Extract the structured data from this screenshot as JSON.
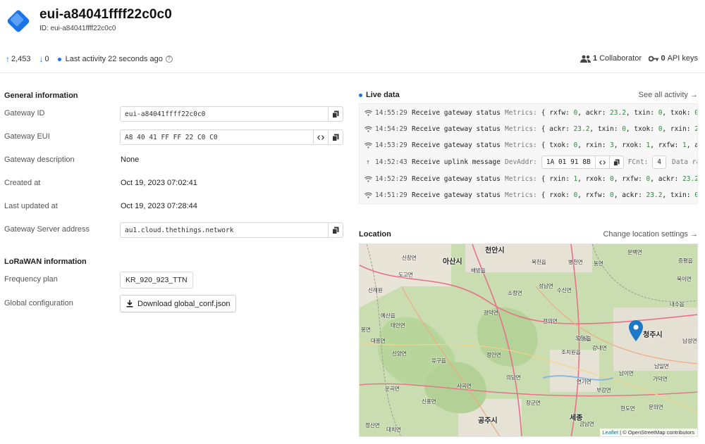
{
  "header": {
    "title": "eui-a84041ffff22c0c0",
    "id_label": "ID:",
    "id_value": "eui-a84041ffff22c0c0",
    "uplink_count": "2,453",
    "downlink_count": "0",
    "last_activity": "Last activity 22 seconds ago",
    "collaborators_count": "1",
    "collaborators_label": "Collaborator",
    "api_keys_count": "0",
    "api_keys_label": "API keys"
  },
  "general": {
    "title": "General information",
    "rows": [
      {
        "label": "Gateway ID",
        "value": "eui-a84041ffff22c0c0"
      },
      {
        "label": "Gateway EUI",
        "value": "A8 40 41 FF FF 22 C0 C0"
      },
      {
        "label": "Gateway description",
        "value": "None"
      },
      {
        "label": "Created at",
        "value": "Oct 19, 2023 07:02:41"
      },
      {
        "label": "Last updated at",
        "value": "Oct 19, 2023 07:28:44"
      },
      {
        "label": "Gateway Server address",
        "value": "au1.cloud.thethings.network"
      }
    ]
  },
  "lorawan": {
    "title": "LoRaWAN information",
    "frequency_label": "Frequency plan",
    "frequency_value": "KR_920_923_TTN",
    "global_label": "Global configuration",
    "download_label": "Download global_conf.json"
  },
  "live": {
    "title": "Live data",
    "see_all": "See all activity →",
    "events": [
      {
        "icon": "wifi-icon",
        "time": "14:55:29",
        "type": "Receive gateway status",
        "label": "Metrics:",
        "text": "{ rxfw: 0, ackr: 23.2, txin: 0, txok: 0, rxin: 1, rxok: 1 }"
      },
      {
        "icon": "wifi-icon",
        "time": "14:54:29",
        "type": "Receive gateway status",
        "label": "Metrics:",
        "text": "{ ackr: 23.2, txin: 0, txok: 0, rxin: 2, rxok: 2, rxfw: 0 }"
      },
      {
        "icon": "wifi-icon",
        "time": "14:53:29",
        "type": "Receive gateway status",
        "label": "Metrics:",
        "text": "{ txok: 0, rxin: 3, rxok: 1, rxfw: 1, ackr: 23.2, txin: 0 }"
      },
      {
        "icon": "arrow-up-icon",
        "time": "14:52:43",
        "type": "Receive uplink message",
        "label": "DevAddr:",
        "devaddr": "1A 01 91 8B",
        "fcnt_label": "FCnt:",
        "fcnt": "4",
        "trail": "Data rate: SF7BW125"
      },
      {
        "icon": "wifi-icon",
        "time": "14:52:29",
        "type": "Receive gateway status",
        "label": "Metrics:",
        "text": "{ rxin: 1, rxok: 0, rxfw: 0, ackr: 23.2, txin: 0, txok: 0 }"
      },
      {
        "icon": "wifi-icon",
        "time": "14:51:29",
        "type": "Receive gateway status",
        "label": "Metrics:",
        "text": "{ rxok: 0, rxfw: 0, ackr: 23.2, txin: 0, txok: 0, rxin: 2 }"
      }
    ]
  },
  "location": {
    "title": "Location",
    "change": "Change location settings →",
    "attribution_leaflet": "Leaflet",
    "attribution_rest": " | © OpenStreetMap contributors",
    "places": [
      {
        "name": "천안시",
        "big": true
      },
      {
        "name": "아산시",
        "big": true
      },
      {
        "name": "세종",
        "big": true
      },
      {
        "name": "청주시",
        "big": true
      },
      {
        "name": "공주시",
        "big": true
      },
      {
        "name": "신창면"
      },
      {
        "name": "도고면"
      },
      {
        "name": "배방읍"
      },
      {
        "name": "목천읍"
      },
      {
        "name": "병천면"
      },
      {
        "name": "오창읍"
      },
      {
        "name": "전의면"
      },
      {
        "name": "조치원읍"
      },
      {
        "name": "연기면"
      },
      {
        "name": "금남면"
      },
      {
        "name": "유구읍"
      },
      {
        "name": "정안면"
      },
      {
        "name": "의당면"
      },
      {
        "name": "사곡면"
      },
      {
        "name": "신풍면"
      },
      {
        "name": "남이면"
      },
      {
        "name": "오송읍"
      },
      {
        "name": "강내면"
      },
      {
        "name": "부강면"
      },
      {
        "name": "현도면"
      },
      {
        "name": "문의면"
      },
      {
        "name": "가덕면"
      },
      {
        "name": "북이면"
      },
      {
        "name": "내수읍"
      },
      {
        "name": "남일면"
      },
      {
        "name": "예산읍"
      },
      {
        "name": "대흥면"
      },
      {
        "name": "신양면"
      },
      {
        "name": "운곡면"
      },
      {
        "name": "정산면"
      },
      {
        "name": "대치면"
      },
      {
        "name": "광덕면"
      },
      {
        "name": "소정면"
      },
      {
        "name": "수신면"
      },
      {
        "name": "성남면"
      },
      {
        "name": "동면"
      },
      {
        "name": "증평읍"
      },
      {
        "name": "문백면"
      },
      {
        "name": "장군면"
      },
      {
        "name": "남성면"
      },
      {
        "name": "태안면"
      },
      {
        "name": "신례원"
      },
      {
        "name": "봉면"
      }
    ]
  }
}
